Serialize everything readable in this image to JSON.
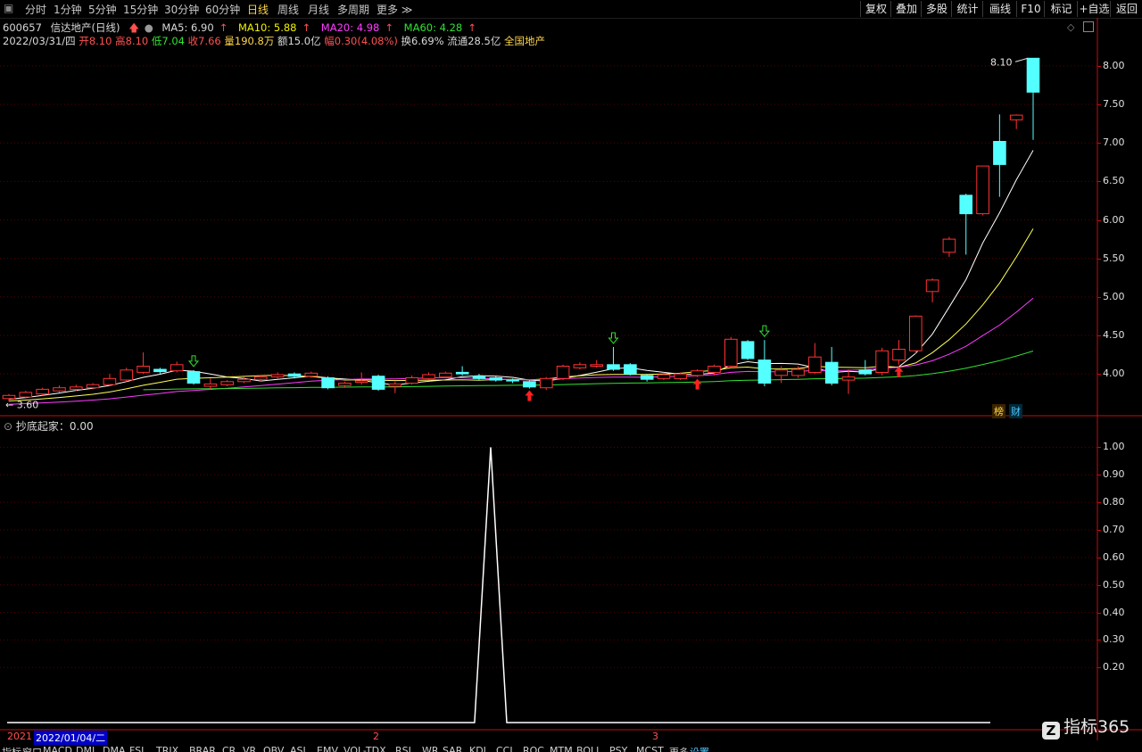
{
  "toolbar": {
    "periods": [
      "分时",
      "1分钟",
      "5分钟",
      "15分钟",
      "30分钟",
      "60分钟",
      "日线",
      "周线",
      "月线",
      "多周期",
      "更多"
    ],
    "active_period": "日线",
    "buttons": [
      "复权",
      "叠加",
      "多股",
      "统计",
      "画线",
      "F10",
      "标记",
      "+自选",
      "返回"
    ]
  },
  "stock": {
    "code": "600657",
    "name": "信达地产(日线)"
  },
  "ma": {
    "ma5": "MA5: 6.90",
    "ma10": "MA10: 5.88",
    "ma20": "MA20: 4.98",
    "ma60": "MA60: 4.28"
  },
  "quote": {
    "date": "2022/03/31/四",
    "open_label": "开",
    "open": "8.10",
    "high_label": "高",
    "high": "8.10",
    "low_label": "低",
    "low": "7.04",
    "close_label": "收",
    "close": "7.66",
    "volume_label": "量",
    "volume": "190.8万",
    "amount_label": "额",
    "amount": "15.0亿",
    "change_label": "幅",
    "change": "0.30(4.08%)",
    "turnover_label": "换",
    "turnover": "6.69%",
    "float_label": "流通",
    "float": "28.5亿",
    "sector": "全国地产"
  },
  "price_axis": {
    "ticks": [
      "8.00",
      "7.50",
      "7.00",
      "6.50",
      "6.00",
      "5.50",
      "5.00",
      "4.50",
      "4.00"
    ],
    "ylim": [
      3.55,
      8.3
    ],
    "max_label": "8.10",
    "min_label": "3.60"
  },
  "indicator": {
    "title": "抄底起家：0.00",
    "ticks": [
      "1.00",
      "0.90",
      "0.80",
      "0.70",
      "0.60",
      "0.50",
      "0.40",
      "0.30",
      "0.20"
    ],
    "ylim": [
      0,
      1.05
    ]
  },
  "tags": {
    "bang": "榜",
    "cai": "财"
  },
  "xaxis": {
    "labels": [
      "2021",
      "2",
      "3"
    ],
    "cursor_date": "2022/01/04/二"
  },
  "bottom_tabs": [
    "指标",
    "窗口",
    "MACD",
    "DMI",
    "DMA",
    "FSL",
    "TRIX",
    "BRAR",
    "CR",
    "VR",
    "OBV",
    "ASI",
    "EMV",
    "VOL-TDX",
    "RSI",
    "WR",
    "SAR",
    "KDJ",
    "CCI",
    "ROC",
    "MTM",
    "BOLL",
    "PSY",
    "MCST",
    "更多",
    "设置"
  ],
  "brand": {
    "name": "指标365"
  },
  "colors": {
    "up": "#ff3232",
    "down": "#54ffff",
    "ma5": "#ffffff",
    "ma10": "#ffff55",
    "ma20": "#ff3cff",
    "ma60": "#32e132",
    "grid": "#5a0000"
  },
  "chart_data": [
    {
      "type": "candlestick",
      "title": "信达地产(日线)",
      "candles": [
        {
          "o": 3.68,
          "c": 3.72,
          "h": 3.74,
          "l": 3.64
        },
        {
          "o": 3.7,
          "c": 3.76,
          "h": 3.78,
          "l": 3.68
        },
        {
          "o": 3.74,
          "c": 3.8,
          "h": 3.82,
          "l": 3.72
        },
        {
          "o": 3.78,
          "c": 3.82,
          "h": 3.85,
          "l": 3.76
        },
        {
          "o": 3.8,
          "c": 3.83,
          "h": 3.86,
          "l": 3.78
        },
        {
          "o": 3.82,
          "c": 3.86,
          "h": 3.88,
          "l": 3.8
        },
        {
          "o": 3.86,
          "c": 3.94,
          "h": 4.0,
          "l": 3.84
        },
        {
          "o": 3.92,
          "c": 4.05,
          "h": 4.08,
          "l": 3.9
        },
        {
          "o": 4.02,
          "c": 4.1,
          "h": 4.28,
          "l": 4.0
        },
        {
          "o": 4.06,
          "c": 4.03,
          "h": 4.08,
          "l": 4.0
        },
        {
          "o": 4.04,
          "c": 4.12,
          "h": 4.16,
          "l": 4.02
        },
        {
          "o": 4.03,
          "c": 3.88,
          "h": 4.05,
          "l": 3.86
        },
        {
          "o": 3.84,
          "c": 3.87,
          "h": 3.94,
          "l": 3.8
        },
        {
          "o": 3.86,
          "c": 3.9,
          "h": 3.92,
          "l": 3.84
        },
        {
          "o": 3.9,
          "c": 3.93,
          "h": 3.96,
          "l": 3.88
        },
        {
          "o": 3.93,
          "c": 3.96,
          "h": 3.98,
          "l": 3.9
        },
        {
          "o": 3.96,
          "c": 3.99,
          "h": 4.02,
          "l": 3.94
        },
        {
          "o": 4.0,
          "c": 3.97,
          "h": 4.02,
          "l": 3.94
        },
        {
          "o": 3.97,
          "c": 4.01,
          "h": 4.03,
          "l": 3.95
        },
        {
          "o": 3.95,
          "c": 3.82,
          "h": 3.97,
          "l": 3.8
        },
        {
          "o": 3.85,
          "c": 3.88,
          "h": 3.9,
          "l": 3.82
        },
        {
          "o": 3.89,
          "c": 3.91,
          "h": 4.02,
          "l": 3.86
        },
        {
          "o": 3.97,
          "c": 3.8,
          "h": 3.99,
          "l": 3.78
        },
        {
          "o": 3.84,
          "c": 3.87,
          "h": 3.9,
          "l": 3.75
        },
        {
          "o": 3.88,
          "c": 3.95,
          "h": 3.98,
          "l": 3.86
        },
        {
          "o": 3.94,
          "c": 3.99,
          "h": 4.02,
          "l": 3.92
        },
        {
          "o": 3.96,
          "c": 4.01,
          "h": 4.03,
          "l": 3.94
        },
        {
          "o": 4.02,
          "c": 4.0,
          "h": 4.1,
          "l": 3.98
        },
        {
          "o": 3.97,
          "c": 3.94,
          "h": 4.0,
          "l": 3.92
        },
        {
          "o": 3.95,
          "c": 3.92,
          "h": 3.97,
          "l": 3.9
        },
        {
          "o": 3.92,
          "c": 3.91,
          "h": 3.94,
          "l": 3.88
        },
        {
          "o": 3.9,
          "c": 3.83,
          "h": 3.92,
          "l": 3.81
        },
        {
          "o": 3.82,
          "c": 3.94,
          "h": 3.96,
          "l": 3.79
        },
        {
          "o": 3.94,
          "c": 4.1,
          "h": 4.12,
          "l": 3.92
        },
        {
          "o": 4.08,
          "c": 4.12,
          "h": 4.15,
          "l": 4.06
        },
        {
          "o": 4.1,
          "c": 4.12,
          "h": 4.18,
          "l": 4.08
        },
        {
          "o": 4.12,
          "c": 4.06,
          "h": 4.35,
          "l": 4.04
        },
        {
          "o": 4.12,
          "c": 4.0,
          "h": 4.14,
          "l": 3.98
        },
        {
          "o": 3.98,
          "c": 3.93,
          "h": 4.0,
          "l": 3.9
        },
        {
          "o": 3.94,
          "c": 3.99,
          "h": 4.02,
          "l": 3.92
        },
        {
          "o": 3.94,
          "c": 4.0,
          "h": 4.02,
          "l": 3.92
        },
        {
          "o": 3.98,
          "c": 4.04,
          "h": 4.06,
          "l": 3.96
        },
        {
          "o": 4.02,
          "c": 4.1,
          "h": 4.12,
          "l": 3.98
        },
        {
          "o": 4.1,
          "c": 4.45,
          "h": 4.48,
          "l": 4.08
        },
        {
          "o": 4.42,
          "c": 4.2,
          "h": 4.44,
          "l": 4.18
        },
        {
          "o": 4.18,
          "c": 3.88,
          "h": 4.44,
          "l": 3.84
        },
        {
          "o": 3.98,
          "c": 4.05,
          "h": 4.1,
          "l": 3.88
        },
        {
          "o": 3.98,
          "c": 4.06,
          "h": 4.1,
          "l": 3.95
        },
        {
          "o": 4.02,
          "c": 4.22,
          "h": 4.4,
          "l": 4.0
        },
        {
          "o": 4.15,
          "c": 3.88,
          "h": 4.35,
          "l": 3.85
        },
        {
          "o": 3.92,
          "c": 3.96,
          "h": 4.06,
          "l": 3.74
        },
        {
          "o": 4.05,
          "c": 4.0,
          "h": 4.18,
          "l": 3.98
        },
        {
          "o": 4.02,
          "c": 4.3,
          "h": 4.34,
          "l": 3.98
        },
        {
          "o": 4.18,
          "c": 4.32,
          "h": 4.44,
          "l": 4.12
        },
        {
          "o": 4.3,
          "c": 4.75,
          "h": 4.76,
          "l": 4.26
        },
        {
          "o": 5.07,
          "c": 5.22,
          "h": 5.24,
          "l": 4.93
        },
        {
          "o": 5.58,
          "c": 5.75,
          "h": 5.78,
          "l": 5.52
        },
        {
          "o": 6.32,
          "c": 6.08,
          "h": 6.34,
          "l": 5.55
        },
        {
          "o": 6.08,
          "c": 6.7,
          "h": 6.7,
          "l": 6.06
        },
        {
          "o": 7.02,
          "c": 6.72,
          "h": 7.37,
          "l": 6.3
        },
        {
          "o": 7.3,
          "c": 7.36,
          "h": 7.37,
          "l": 7.18
        },
        {
          "o": 8.1,
          "c": 7.66,
          "h": 8.1,
          "l": 7.04
        }
      ],
      "ma_start_index": 8
    },
    {
      "type": "line",
      "title": "抄底起家",
      "values": [
        0,
        0,
        0,
        0,
        0,
        0,
        0,
        0,
        0,
        0,
        0,
        0,
        0,
        0,
        0,
        0,
        0,
        0,
        0,
        0,
        0,
        0,
        0,
        0,
        0,
        0,
        0,
        0,
        0,
        0,
        1,
        0,
        0,
        0,
        0,
        0,
        0,
        0,
        0,
        0,
        0,
        0,
        0,
        0,
        0,
        0,
        0,
        0,
        0,
        0,
        0,
        0,
        0,
        0,
        0,
        0,
        0,
        0,
        0,
        0,
        0,
        0
      ],
      "ylim": [
        0,
        1.05
      ]
    }
  ]
}
